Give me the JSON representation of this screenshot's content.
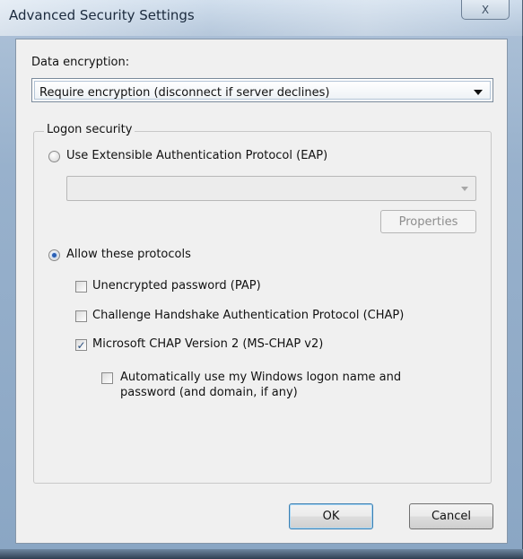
{
  "window": {
    "title": "Advanced Security Settings",
    "close_glyph": "X"
  },
  "encryption": {
    "label": "Data encryption:",
    "selected": "Require encryption (disconnect if server declines)"
  },
  "logon": {
    "legend": "Logon security",
    "eap_radio_label": "Use Extensible Authentication Protocol (EAP)",
    "eap_radio_checked": false,
    "eap_select_value": "",
    "properties_label": "Properties",
    "allow_radio_label": "Allow these protocols",
    "allow_radio_checked": true,
    "protocols": [
      {
        "label": "Unencrypted password (PAP)",
        "checked": false
      },
      {
        "label": "Challenge Handshake Authentication Protocol (CHAP)",
        "checked": false
      },
      {
        "label": "Microsoft CHAP Version 2 (MS-CHAP v2)",
        "checked": true
      }
    ],
    "auto_logon_line1": "Automatically use my Windows logon name and",
    "auto_logon_line2": "password (and domain, if any)",
    "auto_logon_checked": false
  },
  "buttons": {
    "ok": "OK",
    "cancel": "Cancel"
  },
  "icons": {
    "close": "close-icon",
    "dropdown": "chevron-down-icon",
    "checkmark": "checkmark-icon"
  },
  "colors": {
    "title_bar": "#9cb4cf",
    "client_bg": "#f0f0f0",
    "radio_dot": "#2b5fb4",
    "default_button_border": "#3c7fb1"
  }
}
